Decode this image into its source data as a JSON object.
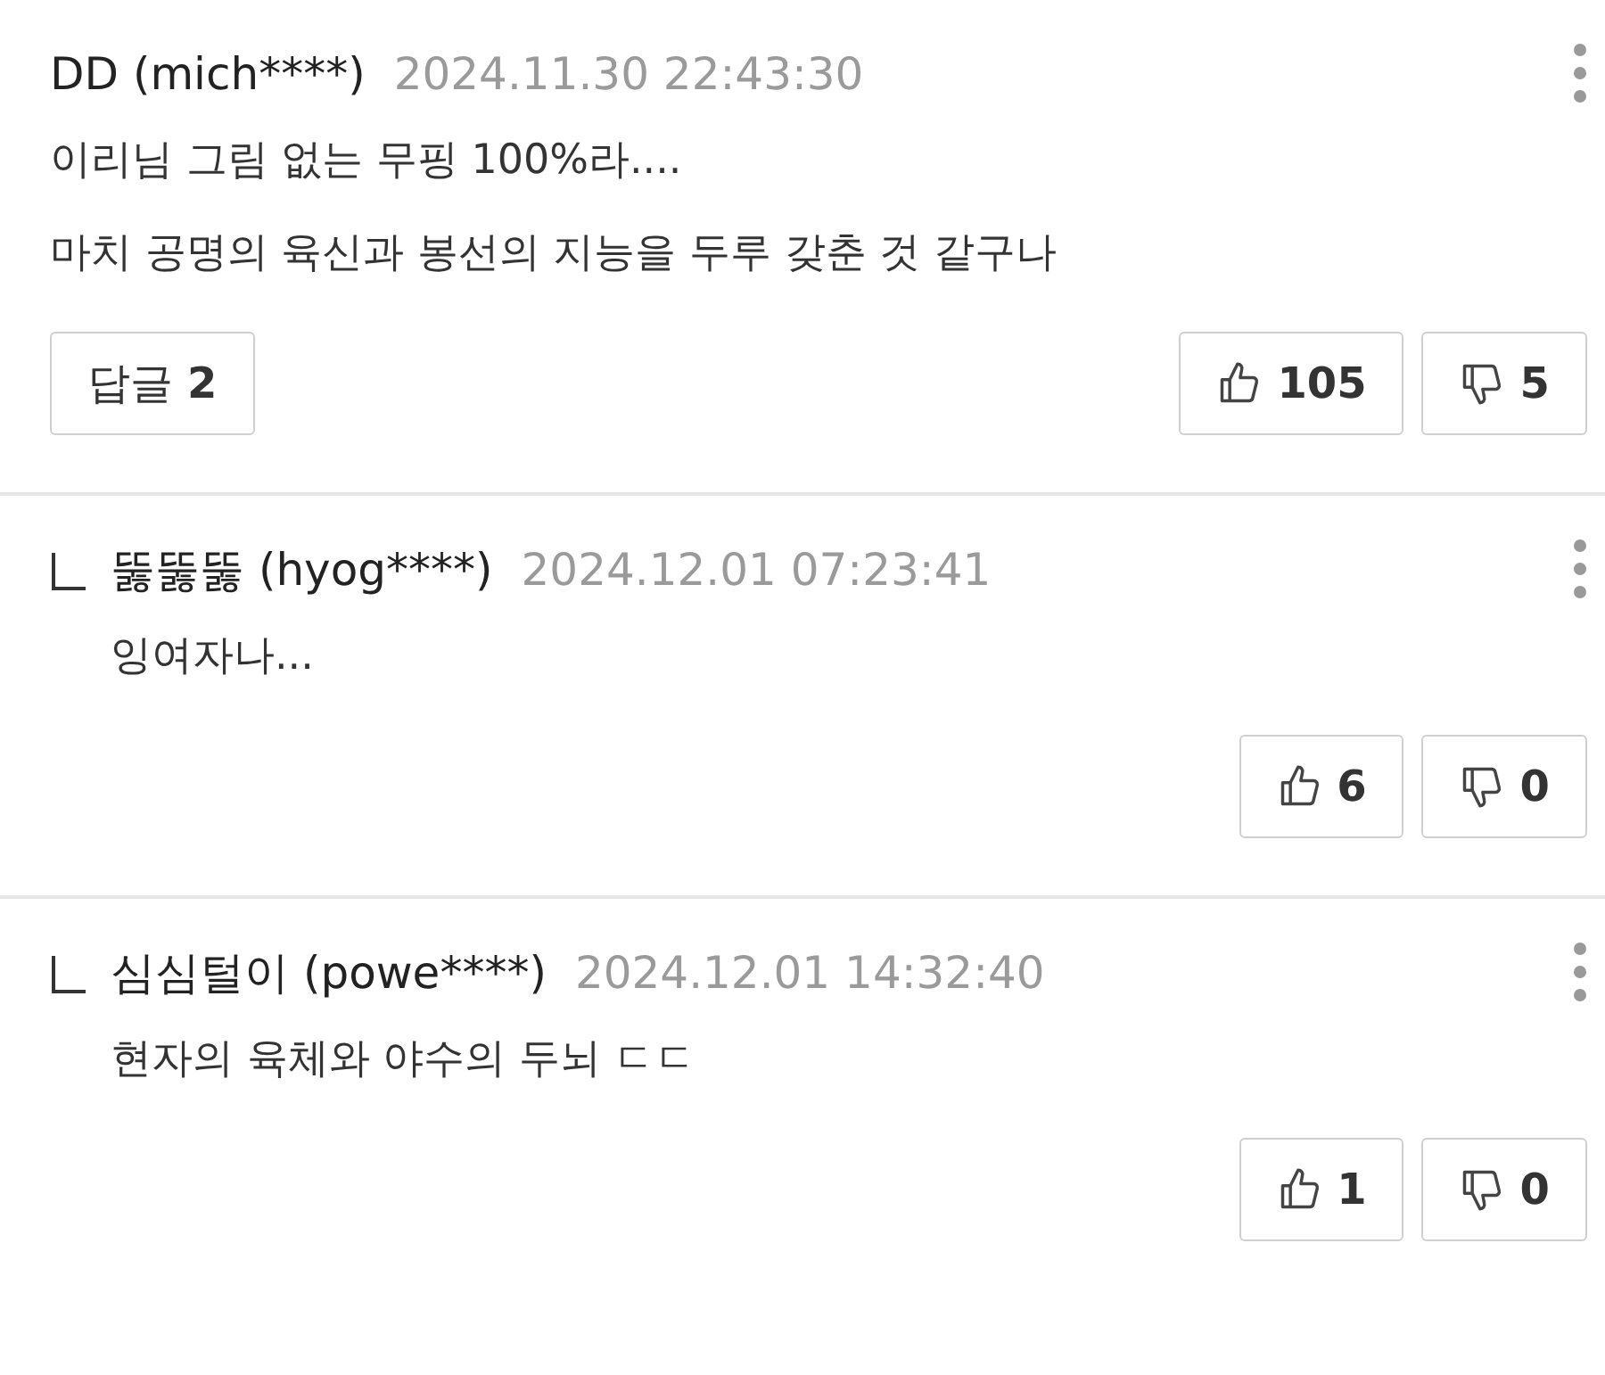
{
  "comments": [
    {
      "kind": "comment",
      "author": "DD (mich****)",
      "time": "2024.11.30 22:43:30",
      "lines": [
        "이리님 그림 없는 무핑 100%라....",
        "마치 공명의 육신과 봉선의 지능을 두루 갖춘 것 같구나"
      ],
      "reply_label": "답글",
      "reply_count": "2",
      "likes": "105",
      "dislikes": "5"
    },
    {
      "kind": "reply",
      "author": "뚫뚫뚫 (hyog****)",
      "time": "2024.12.01 07:23:41",
      "lines": [
        "잉여자나..."
      ],
      "likes": "6",
      "dislikes": "0"
    },
    {
      "kind": "reply",
      "author": "심심털이 (powe****)",
      "time": "2024.12.01 14:32:40",
      "lines": [
        "현자의 육체와 야수의 두뇌 ㄷㄷ"
      ],
      "likes": "1",
      "dislikes": "0"
    }
  ]
}
